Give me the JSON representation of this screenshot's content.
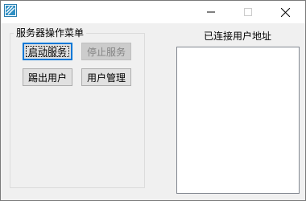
{
  "window": {
    "icon": "app-icon"
  },
  "controls": {
    "minimize_icon": "minimize-icon",
    "maximize_icon": "maximize-icon",
    "close_icon": "close-icon"
  },
  "server_menu": {
    "title": "服务器操作菜单",
    "start_label": "启动服务",
    "stop_label": "停止服务",
    "kick_label": "踢出用户",
    "manage_label": "用户管理"
  },
  "connected": {
    "label": "已连接用户地址",
    "items": []
  },
  "colors": {
    "accent": "#0078d7",
    "window_bg": "#f0f0f0"
  }
}
